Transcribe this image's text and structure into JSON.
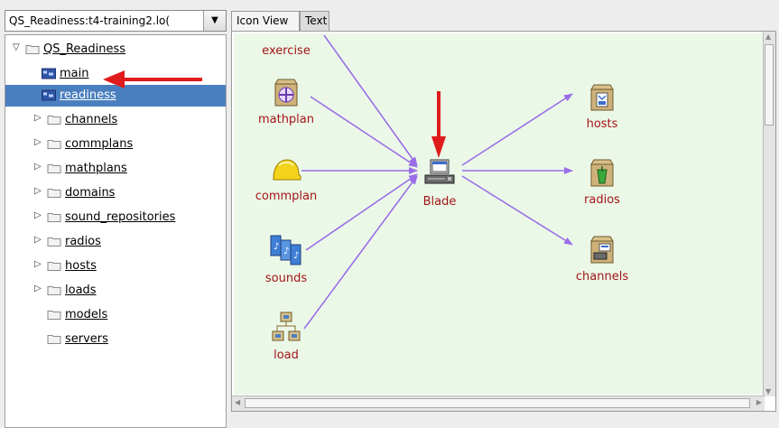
{
  "selector": {
    "value": "QS_Readiness:t4-training2.lo("
  },
  "tree": {
    "items": [
      {
        "label": "QS_Readiness",
        "expander": "▽",
        "icon": "folder-icon"
      },
      {
        "label": "main",
        "expander": "",
        "icon": "view-icon"
      },
      {
        "label": "readiness",
        "expander": "",
        "icon": "view-icon",
        "selected": true
      },
      {
        "label": "channels",
        "expander": "▷",
        "icon": "folder-icon"
      },
      {
        "label": "commplans",
        "expander": "▷",
        "icon": "folder-icon"
      },
      {
        "label": "mathplans",
        "expander": "▷",
        "icon": "folder-icon"
      },
      {
        "label": "domains",
        "expander": "▷",
        "icon": "folder-icon"
      },
      {
        "label": "sound_repositories",
        "expander": "▷",
        "icon": "folder-icon"
      },
      {
        "label": "radios",
        "expander": "▷",
        "icon": "folder-icon"
      },
      {
        "label": "hosts",
        "expander": "▷",
        "icon": "folder-icon"
      },
      {
        "label": "loads",
        "expander": "▷",
        "icon": "folder-icon"
      },
      {
        "label": "models",
        "expander": "",
        "icon": "folder-icon"
      },
      {
        "label": "servers",
        "expander": "",
        "icon": "folder-icon"
      }
    ]
  },
  "tabs": [
    "Icon View",
    "Text"
  ],
  "graph": {
    "nodes": {
      "exercise": "exercise",
      "mathplan": "mathplan",
      "commplan": "commplan",
      "sounds": "sounds",
      "load": "load",
      "blade": "Blade",
      "hosts": "hosts",
      "radios": "radios",
      "channels": "channels"
    }
  },
  "colors": {
    "edge": "#9a6ee6",
    "annotation_arrow": "#e01b1b",
    "node_label": "#a31515",
    "canvas_bg": "#ebf8e8",
    "selection": "#4a7fbf"
  }
}
